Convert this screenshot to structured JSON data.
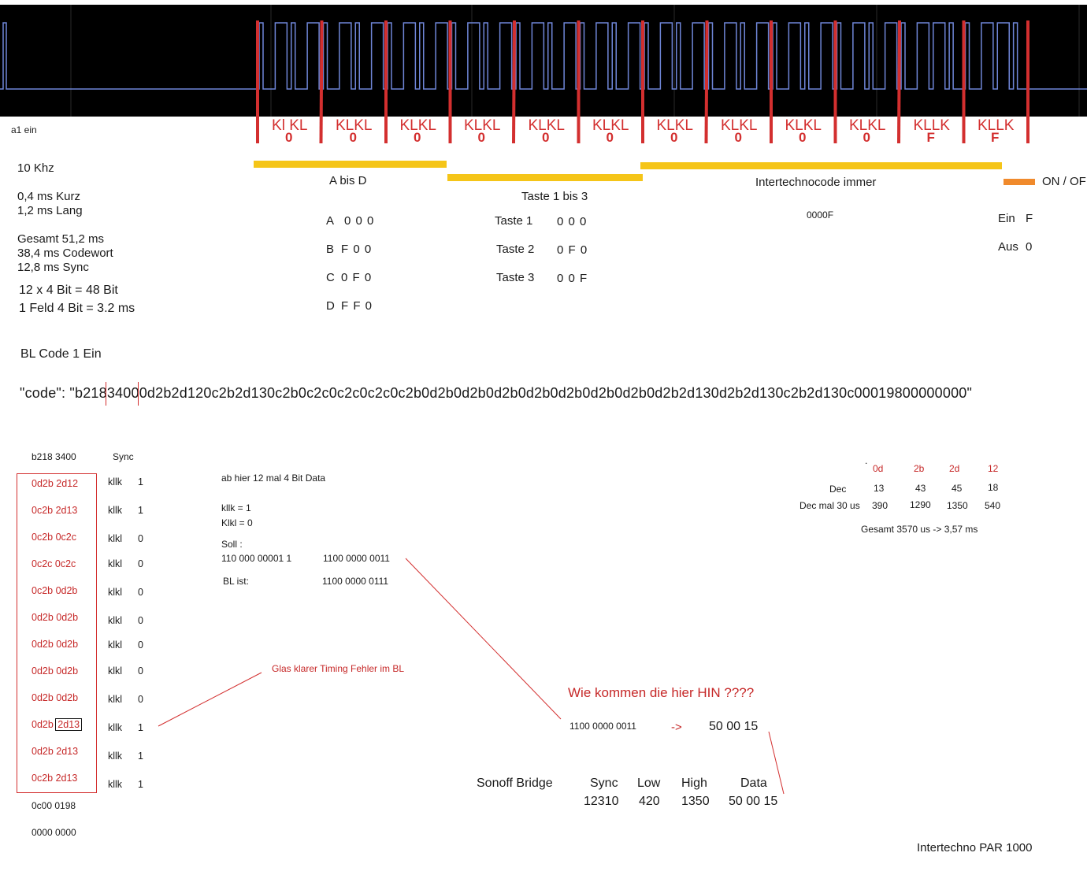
{
  "scope": {
    "wave_color": "#6f86d8",
    "marker_color": "#d32f2f",
    "label_color": "#d32f2f",
    "segments": [
      {
        "top": "Kl KL",
        "bottom": "0"
      },
      {
        "top": "KLKL",
        "bottom": "0"
      },
      {
        "top": "KLKL",
        "bottom": "0"
      },
      {
        "top": "KLKL",
        "bottom": "0"
      },
      {
        "top": "KLKL",
        "bottom": "0"
      },
      {
        "top": "KLKL",
        "bottom": "0"
      },
      {
        "top": "KLKL",
        "bottom": "0"
      },
      {
        "top": "KLKL",
        "bottom": "0"
      },
      {
        "top": "KLKL",
        "bottom": "0"
      },
      {
        "top": "KLKL",
        "bottom": "0"
      },
      {
        "top": "KLLK",
        "bottom": "F"
      },
      {
        "top": "KLLK",
        "bottom": "F"
      }
    ]
  },
  "left_info": {
    "a1": "a1 ein",
    "freq": "10 Khz",
    "short": "0,4 ms Kurz",
    "long": "1,2 ms Lang",
    "total": "Gesamt 51,2 ms",
    "codeword": "38,4 ms Codewort",
    "sync": "12,8 ms Sync",
    "bits": "12 x  4 Bit = 48 Bit",
    "field": "1 Feld 4 Bit = 3.2 ms"
  },
  "groups": {
    "a_to_d": {
      "title": "A bis D",
      "rows": [
        {
          "k": "A",
          "v": "0 0 0"
        },
        {
          "k": "B",
          "v": "F 0 0"
        },
        {
          "k": "C",
          "v": "0 F 0"
        },
        {
          "k": "D",
          "v": "F F 0"
        }
      ]
    },
    "taste": {
      "title": "Taste 1 bis 3",
      "rows": [
        {
          "k": "Taste  1",
          "v": "0 0 0"
        },
        {
          "k": "Taste  2",
          "v": "0 F 0"
        },
        {
          "k": "Taste  3",
          "v": "0 0 F"
        }
      ]
    },
    "intertechno": {
      "title": "Intertechnocode immer",
      "value": "0000F"
    },
    "onoff": {
      "title": "ON / OF",
      "ein_k": "Ein",
      "ein_v": "F",
      "aus_k": "Aus",
      "aus_v": "0",
      "color": "#f08a2c"
    },
    "bar_color": "#f5c518"
  },
  "bl": {
    "title": "BL Code 1 Ein",
    "code": "\"code\": \"b21834000d2b2d120c2b2d130c2b0c2c0c2c0c2c0c2b0d2b0d2b0d2b0d2b0d2b0d2b0d2b0d2b2d130d2b2d130c2b2d130c00019800000000\""
  },
  "table": {
    "header_left": "b218 3400",
    "header_right": "Sync",
    "rows": [
      {
        "hex": "0d2b 2d12",
        "bits": "kllk",
        "v": "1"
      },
      {
        "hex": "0c2b 2d13",
        "bits": "kllk",
        "v": "1"
      },
      {
        "hex": "0c2b 0c2c",
        "bits": "klkl",
        "v": "0"
      },
      {
        "hex": "0c2c 0c2c",
        "bits": "klkl",
        "v": "0"
      },
      {
        "hex": "0c2b 0d2b",
        "bits": "klkl",
        "v": "0"
      },
      {
        "hex": "0d2b 0d2b",
        "bits": "klkl",
        "v": "0"
      },
      {
        "hex": "0d2b 0d2b",
        "bits": "klkl",
        "v": "0"
      },
      {
        "hex": "0d2b 0d2b",
        "bits": "klkl",
        "v": "0"
      },
      {
        "hex": "0d2b 0d2b",
        "bits": "klkl",
        "v": "0"
      },
      {
        "hex_a": "0d2b",
        "hex_b": "2d13",
        "bits": "kllk",
        "v": "1"
      },
      {
        "hex": "0d2b 2d13",
        "bits": "kllk",
        "v": "1"
      },
      {
        "hex": "0c2b 2d13",
        "bits": "kllk",
        "v": "1"
      }
    ],
    "footer1": "0c00 0198",
    "footer2": "0000 0000"
  },
  "notes": {
    "ab_hier": "ab hier 12 mal 4 Bit Data",
    "kllk": "kllk =  1",
    "klkl": "Klkl = 0",
    "soll": "Soll :",
    "soll_a": "110   000  00001 1",
    "soll_b": "1100 0000 0011",
    "bl_ist": "BL ist:",
    "bl_ist_v": "1100 0000 0111",
    "glas": "Glas klarer Timing Fehler im BL",
    "wie": "Wie kommen die hier HIN ????",
    "bin": "1100 0000 0011",
    "arrow": "->",
    "hex_out": "50 00 15"
  },
  "sonoff": {
    "label": "Sonoff Bridge",
    "cols": [
      {
        "h": "Sync",
        "v": "12310"
      },
      {
        "h": "Low",
        "v": "420"
      },
      {
        "h": "High",
        "v": "1350"
      },
      {
        "h": "Data",
        "v": "50 00 15"
      }
    ]
  },
  "dec_table": {
    "dot": ".",
    "headers": [
      "0d",
      "2b",
      "2d",
      "12"
    ],
    "dec_label": "Dec",
    "dec": [
      "13",
      "43",
      "45",
      "18"
    ],
    "mal_label": "Dec mal 30 us",
    "mal": [
      "390",
      "1290",
      "1350",
      "540"
    ],
    "gesamt": "Gesamt 3570 us -> 3,57 ms"
  },
  "footer": "Intertechno  PAR 1000"
}
